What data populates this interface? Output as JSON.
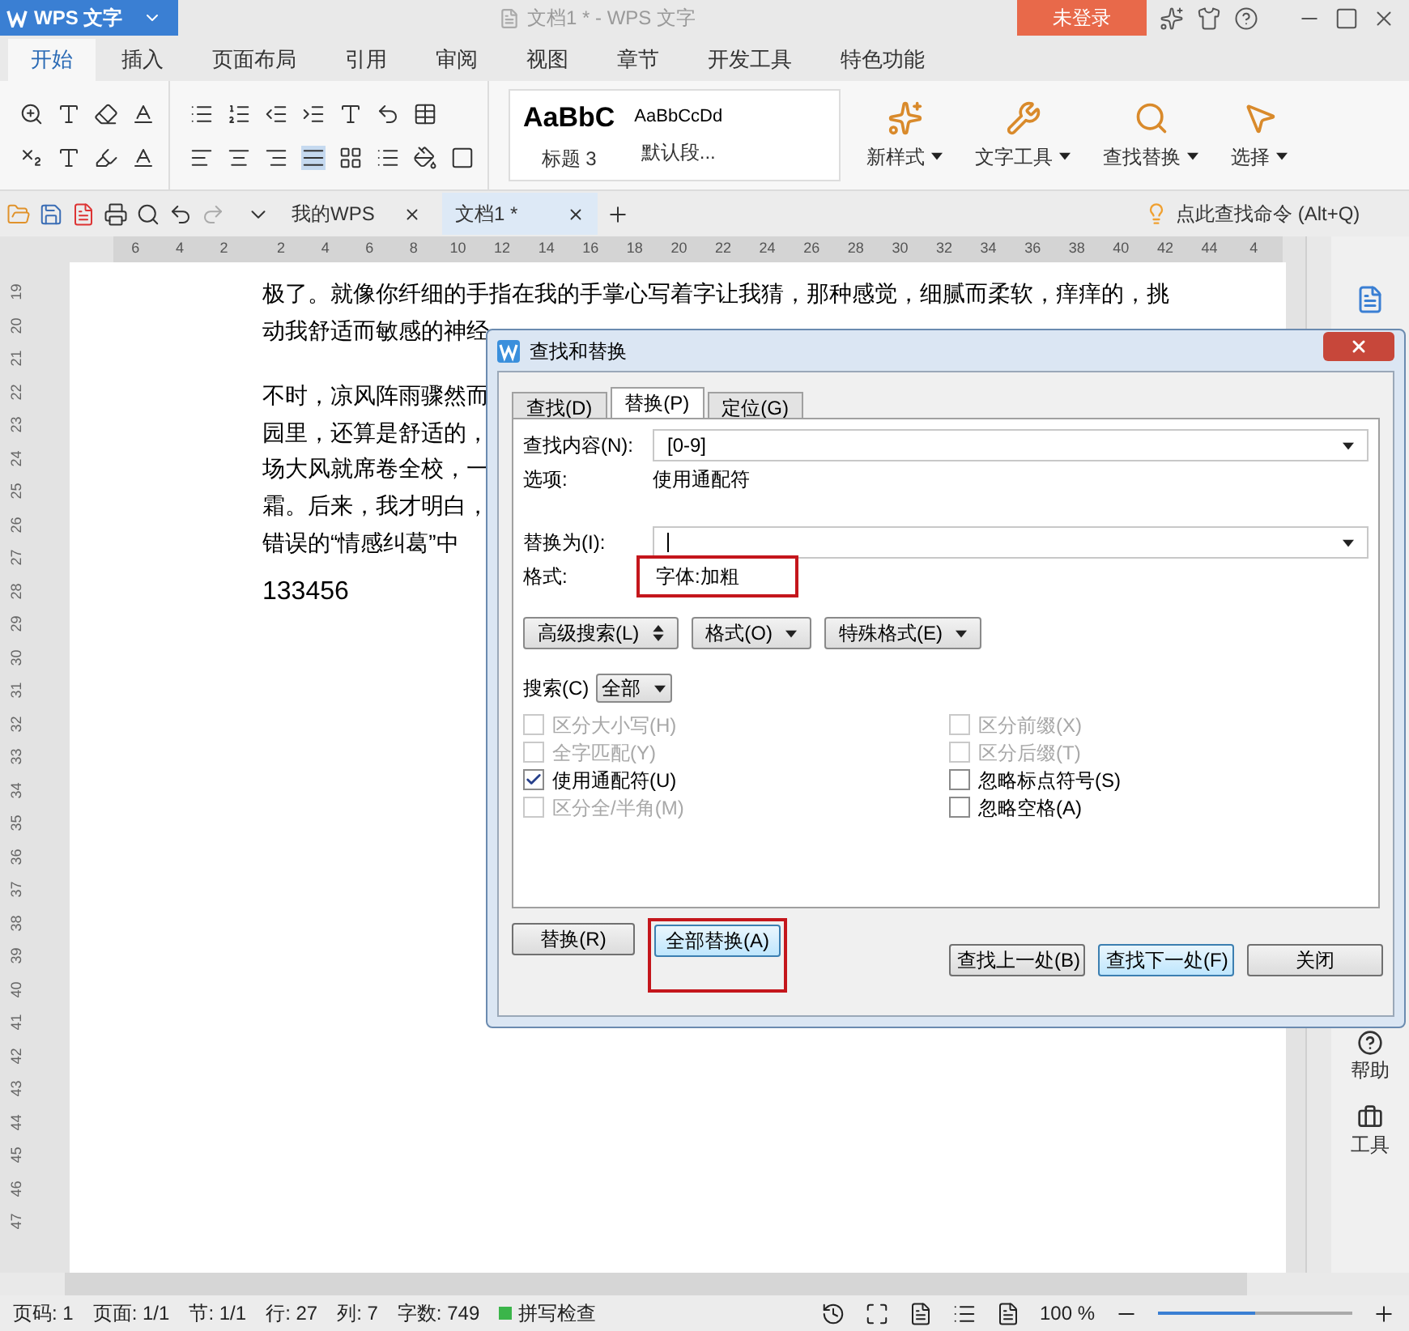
{
  "app_button": {
    "label": "WPS 文字"
  },
  "window": {
    "title": "文档1 * - WPS 文字",
    "login": "未登录"
  },
  "ribbon_tabs": [
    {
      "label": "开始",
      "selected": true
    },
    {
      "label": "插入",
      "selected": false
    },
    {
      "label": "页面布局",
      "selected": false
    },
    {
      "label": "引用",
      "selected": false
    },
    {
      "label": "审阅",
      "selected": false
    },
    {
      "label": "视图",
      "selected": false
    },
    {
      "label": "章节",
      "selected": false
    },
    {
      "label": "开发工具",
      "selected": false
    },
    {
      "label": "特色功能",
      "selected": false
    }
  ],
  "styles": [
    {
      "sample": "AaBbC",
      "name": "标题 3"
    },
    {
      "sample": "AaBbCcDd",
      "name": "默认段..."
    }
  ],
  "ribbon_tools": [
    {
      "label": "新样式"
    },
    {
      "label": "文字工具"
    },
    {
      "label": "查找替换"
    },
    {
      "label": "选择"
    }
  ],
  "doc_tabs": [
    {
      "label": "我的WPS",
      "selected": false
    },
    {
      "label": "文档1 *",
      "selected": true
    }
  ],
  "command_search": {
    "placeholder": "点此查找命令 (Alt+Q)"
  },
  "ruler": {
    "labels": [
      "6",
      "4",
      "2",
      "2",
      "4",
      "6",
      "8",
      "10",
      "12",
      "14",
      "16",
      "18",
      "20",
      "22",
      "24",
      "26",
      "28",
      "30",
      "32",
      "34",
      "36",
      "38",
      "40",
      "42",
      "44",
      "4"
    ]
  },
  "vertical_ruler": {
    "labels": [
      "19",
      "20",
      "21",
      "22",
      "23",
      "24",
      "25",
      "26",
      "27",
      "28",
      "29",
      "30",
      "31",
      "32",
      "33",
      "34",
      "35",
      "36",
      "37",
      "38",
      "39",
      "40",
      "41",
      "42",
      "43",
      "44",
      "45",
      "46",
      "47"
    ]
  },
  "document": {
    "paragraphs": [
      {
        "kind": "body",
        "lines": [
          "极了。就像你纤细的手指在我的手掌心写着字让我猜，那种感觉，细腻而柔软，痒痒的，挑",
          "动我舒适而敏感的神经"
        ]
      },
      {
        "kind": "body",
        "lines": [
          "不时，凉风阵雨骤然而",
          "园里，还算是舒适的，",
          "场大风就席卷全校，一",
          "霜。后来，我才明白，",
          "错误的“情感纠葛”中"
        ]
      },
      {
        "kind": "large",
        "lines": [
          "133456"
        ]
      }
    ]
  },
  "sidebar": [
    {
      "label": "帮助"
    },
    {
      "label": "工具"
    }
  ],
  "dialog": {
    "title": "查找和替换",
    "tabs": [
      {
        "label": "查找(D)",
        "selected": false
      },
      {
        "label": "替换(P)",
        "selected": true
      },
      {
        "label": "定位(G)",
        "selected": false
      }
    ],
    "find": {
      "label": "查找内容(N):",
      "value": "[0-9]"
    },
    "options": {
      "label": "选项:",
      "value": "使用通配符"
    },
    "replace": {
      "label": "替换为(I):"
    },
    "format": {
      "label": "格式:",
      "value": "字体:加粗",
      "highlighted": true
    },
    "menu_buttons": [
      {
        "label": "高级搜索(L)",
        "kind": "updown"
      },
      {
        "label": "格式(O)",
        "kind": "dropdown"
      },
      {
        "label": "特殊格式(E)",
        "kind": "dropdown"
      }
    ],
    "search": {
      "label": "搜索(C)",
      "value": "全部"
    },
    "checkboxes_left": [
      {
        "label": "区分大小写(H)",
        "checked": false,
        "disabled": true
      },
      {
        "label": "全字匹配(Y)",
        "checked": false,
        "disabled": true
      },
      {
        "label": "使用通配符(U)",
        "checked": true,
        "disabled": false
      },
      {
        "label": "区分全/半角(M)",
        "checked": false,
        "disabled": true
      }
    ],
    "checkboxes_right": [
      {
        "label": "区分前缀(X)",
        "checked": false,
        "disabled": true
      },
      {
        "label": "区分后缀(T)",
        "checked": false,
        "disabled": true
      },
      {
        "label": "忽略标点符号(S)",
        "checked": false,
        "disabled": false
      },
      {
        "label": "忽略空格(A)",
        "checked": false,
        "disabled": false
      }
    ],
    "replace_buttons": [
      {
        "label": "替换(R)",
        "highlighted": false,
        "focused": false
      },
      {
        "label": "全部替换(A)",
        "highlighted": true,
        "focused": true
      }
    ],
    "nav_buttons": [
      {
        "label": "查找上一处(B)",
        "focused": false
      },
      {
        "label": "查找下一处(F)",
        "focused": true
      },
      {
        "label": "关闭",
        "focused": false
      }
    ]
  },
  "status_bar": {
    "items": [
      "页码: 1",
      "页面: 1/1",
      "节: 1/1",
      "行: 27",
      "列: 7",
      "字数: 749"
    ],
    "spell": "拼写检查",
    "zoom": "100 %",
    "zoom_slider": {
      "level": 0.5
    }
  }
}
